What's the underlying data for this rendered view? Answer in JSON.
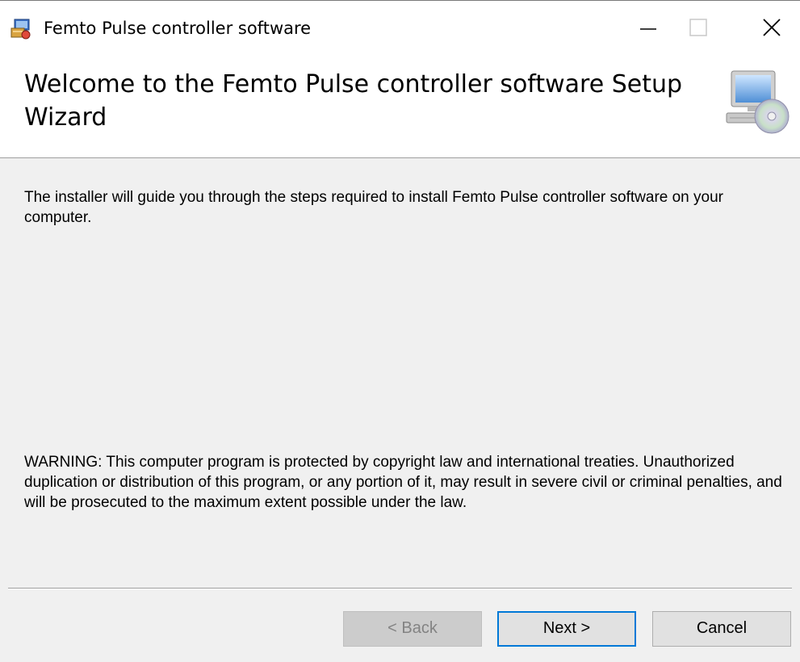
{
  "window": {
    "title": "Femto Pulse controller software"
  },
  "banner": {
    "title": "Welcome to the Femto Pulse controller software Setup Wizard",
    "icon": "computer-disc-icon"
  },
  "body": {
    "intro": "The installer will guide you through the steps required to install Femto Pulse controller software on your computer.",
    "warning": "WARNING: This computer program is protected by copyright law and international treaties. Unauthorized duplication or distribution of this program, or any portion of it, may result in severe civil or criminal penalties, and will be prosecuted to the maximum extent possible under the law."
  },
  "buttons": {
    "back": "< Back",
    "next": "Next >",
    "cancel": "Cancel"
  },
  "colors": {
    "focus_border": "#0078d7",
    "background": "#f0f0f0"
  }
}
